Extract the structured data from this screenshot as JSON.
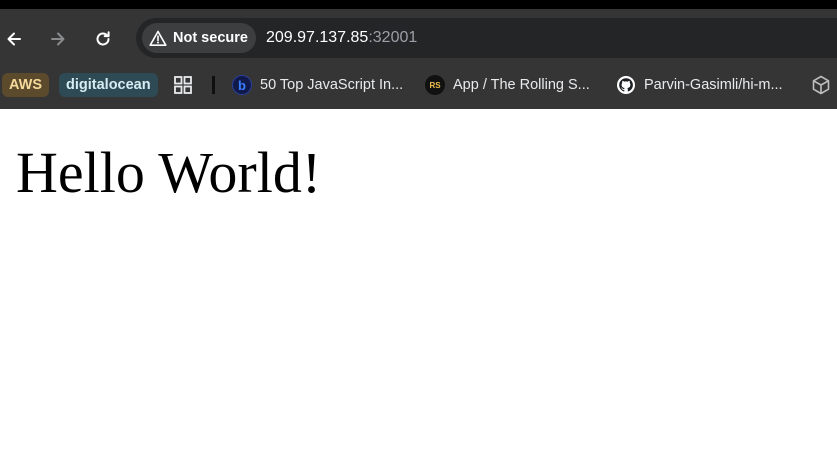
{
  "browser": {
    "address_bar": {
      "security_label": "Not secure",
      "url_host": "209.97.137.85",
      "url_port": ":32001"
    },
    "bookmarks": [
      {
        "label": "AWS",
        "color": "#5b4a2c"
      },
      {
        "label": "digitalocean",
        "color": "#2e4a55"
      },
      {
        "label": "50 Top JavaScript In...",
        "favicon_text": "b"
      },
      {
        "label": "App / The Rolling S...",
        "favicon_text": "RS"
      },
      {
        "label": "Parvin-Gasimli/hi-m...",
        "icon": "github-icon"
      }
    ]
  },
  "page": {
    "heading": "Hello World!"
  },
  "colors": {
    "toolbar_bg": "#353536",
    "omnibox_bg": "#242526",
    "page_bg": "#ffffff"
  }
}
